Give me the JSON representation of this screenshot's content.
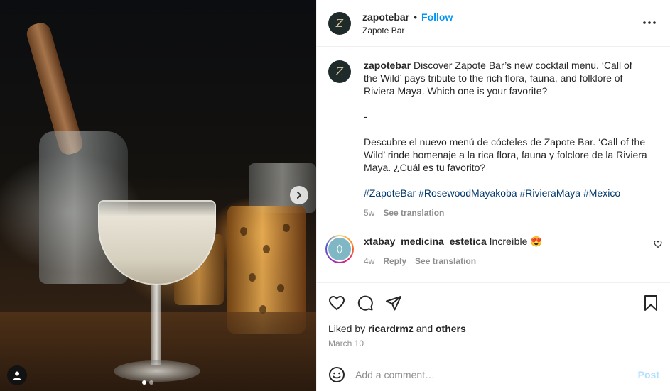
{
  "post": {
    "username": "zapotebar",
    "separator": "•",
    "follow_label": "Follow",
    "location": "Zapote Bar",
    "avatar_letter": "Z"
  },
  "caption": {
    "username": "zapotebar",
    "text_en": "Discover Zapote Bar’s new cocktail menu. ‘Call of the Wild’ pays tribute to the rich flora, fauna, and folklore of Riviera Maya. Which one is your favorite?",
    "divider": "-",
    "text_es": "Descubre el nuevo menú de cócteles de Zapote Bar. ‘Call of the Wild’ rinde homenaje a la rica flora, fauna y folclore de la Riviera Maya. ¿Cuál es tu favorito?",
    "hashtags": [
      "#ZapoteBar",
      "#RosewoodMayakoba",
      "#RivieraMaya",
      "#Mexico"
    ],
    "time": "5w",
    "see_translation": "See translation"
  },
  "comment": {
    "username": "xtabay_medicina_estetica",
    "text": "Increíble",
    "emoji": "😍",
    "time": "4w",
    "reply": "Reply",
    "see_translation": "See translation"
  },
  "likes": {
    "prefix": "Liked by",
    "user": "ricardrmz",
    "and": "and",
    "others": "others"
  },
  "date": "March 10",
  "add_comment": {
    "placeholder": "Add a comment…",
    "post_label": "Post"
  },
  "colors": {
    "accent": "#0095f6",
    "hashtag": "#00376b",
    "muted": "#8e8e8e",
    "post_disabled": "#b2dffc"
  },
  "icons": [
    "chevron-right-icon",
    "person-tag-icon",
    "more-icon",
    "heart-icon",
    "comment-icon",
    "share-icon",
    "save-icon",
    "smiley-icon"
  ]
}
